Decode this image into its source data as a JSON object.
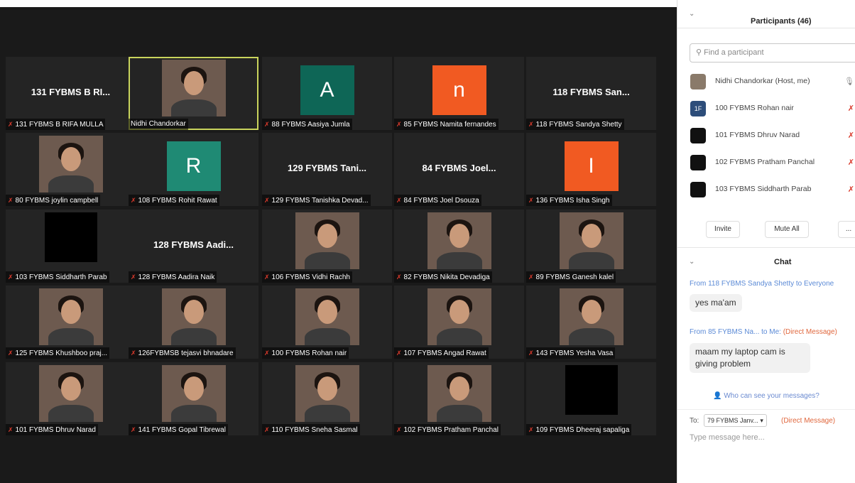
{
  "gallery": {
    "tiles": [
      {
        "name": "131 FYBMS B RIFA MULLA",
        "display": "131 FYBMS B RI...",
        "kind": "name",
        "muted": true
      },
      {
        "name": "Nidhi Chandorkar",
        "kind": "photo",
        "active": true,
        "muted": false
      },
      {
        "name": "88 FYBMS Aasiya Jumla",
        "letter": "A",
        "kind": "letter",
        "color": "#0e6656",
        "muted": true
      },
      {
        "name": "85 FYBMS Namita fernandes",
        "letter": "n",
        "kind": "letter",
        "color": "#f15a22",
        "muted": true
      },
      {
        "name": "118  FYBMS Sandya Shetty",
        "display": "118  FYBMS San...",
        "kind": "name",
        "muted": true
      },
      {
        "name": "80 FYBMS joylin campbell",
        "kind": "photo",
        "muted": true
      },
      {
        "name": "108 FYBMS Rohit Rawat",
        "letter": "R",
        "kind": "letter",
        "color": "#1f8a74",
        "muted": true
      },
      {
        "name": "129 FYBMS Tanishka Devad...",
        "display": "129 FYBMS Tani...",
        "kind": "name",
        "muted": true
      },
      {
        "name": "84 FYBMS Joel Dsouza",
        "display": "84 FYBMS Joel...",
        "kind": "name",
        "muted": true
      },
      {
        "name": "136 FYBMS Isha Singh",
        "letter": "I",
        "kind": "letter",
        "color": "#f15a22",
        "muted": true
      },
      {
        "name": "103 FYBMS Siddharth Parab",
        "kind": "dark",
        "muted": true
      },
      {
        "name": "128 FYBMS Aadira Naik",
        "display": "128 FYBMS Aadi...",
        "kind": "name",
        "muted": true
      },
      {
        "name": "106 FYBMS Vidhi Rachh",
        "kind": "photo",
        "muted": true
      },
      {
        "name": "82 FYBMS Nikita Devadiga",
        "kind": "photo",
        "muted": true
      },
      {
        "name": "89 FYBMS Ganesh kalel",
        "kind": "photo",
        "muted": true
      },
      {
        "name": "125 FYBMS Khushboo praj...",
        "kind": "photo",
        "muted": true
      },
      {
        "name": "126FYBMSB tejasvi bhnadare",
        "kind": "photo",
        "muted": true
      },
      {
        "name": "100 FYBMS Rohan nair",
        "kind": "photo",
        "muted": true
      },
      {
        "name": "107 FYBMS Angad Rawat",
        "kind": "photo",
        "muted": true
      },
      {
        "name": "143 FYBMS Yesha Vasa",
        "kind": "photo",
        "muted": true
      },
      {
        "name": "101 FYBMS Dhruv Narad",
        "kind": "photo",
        "muted": true
      },
      {
        "name": "141 FYBMS  Gopal Tibrewal",
        "kind": "photo",
        "muted": true
      },
      {
        "name": "110 FYBMS Sneha Sasmal",
        "kind": "photo",
        "muted": true
      },
      {
        "name": "102 FYBMS Pratham Panchal",
        "kind": "photo",
        "muted": true
      },
      {
        "name": "109 FYBMS Dheeraj sapaliga",
        "kind": "dark",
        "muted": true
      }
    ]
  },
  "participants": {
    "title": "Participants (46)",
    "search_placeholder": "Find a participant",
    "list": [
      {
        "name": "Nidhi Chandorkar (Host, me)",
        "avatar": "",
        "host": true
      },
      {
        "name": "100 FYBMS Rohan nair",
        "avatar": "1F",
        "host": false
      },
      {
        "name": "101 FYBMS Dhruv Narad",
        "avatar": "",
        "host": false
      },
      {
        "name": "102 FYBMS Pratham Panchal",
        "avatar": "",
        "host": false
      },
      {
        "name": "103 FYBMS Siddharth Parab",
        "avatar": "",
        "host": false
      }
    ],
    "buttons": {
      "invite": "Invite",
      "mute_all": "Mute All",
      "more": "..."
    }
  },
  "chat": {
    "title": "Chat",
    "messages": [
      {
        "from_label": "From 118  FYBMS Sandya Shetty to Everyone",
        "text": "yes ma'am"
      },
      {
        "from_label": "From 85 FYBMS Na...  to Me:",
        "dm": "(Direct Message)",
        "text": "maam my laptop cam is giving problem"
      }
    ],
    "who_can_see": "Who can see your messages?",
    "to_label": "To:",
    "to_value": "79 FYBMS Janv...",
    "dm_tag": "(Direct Message)",
    "input_placeholder": "Type message here..."
  }
}
